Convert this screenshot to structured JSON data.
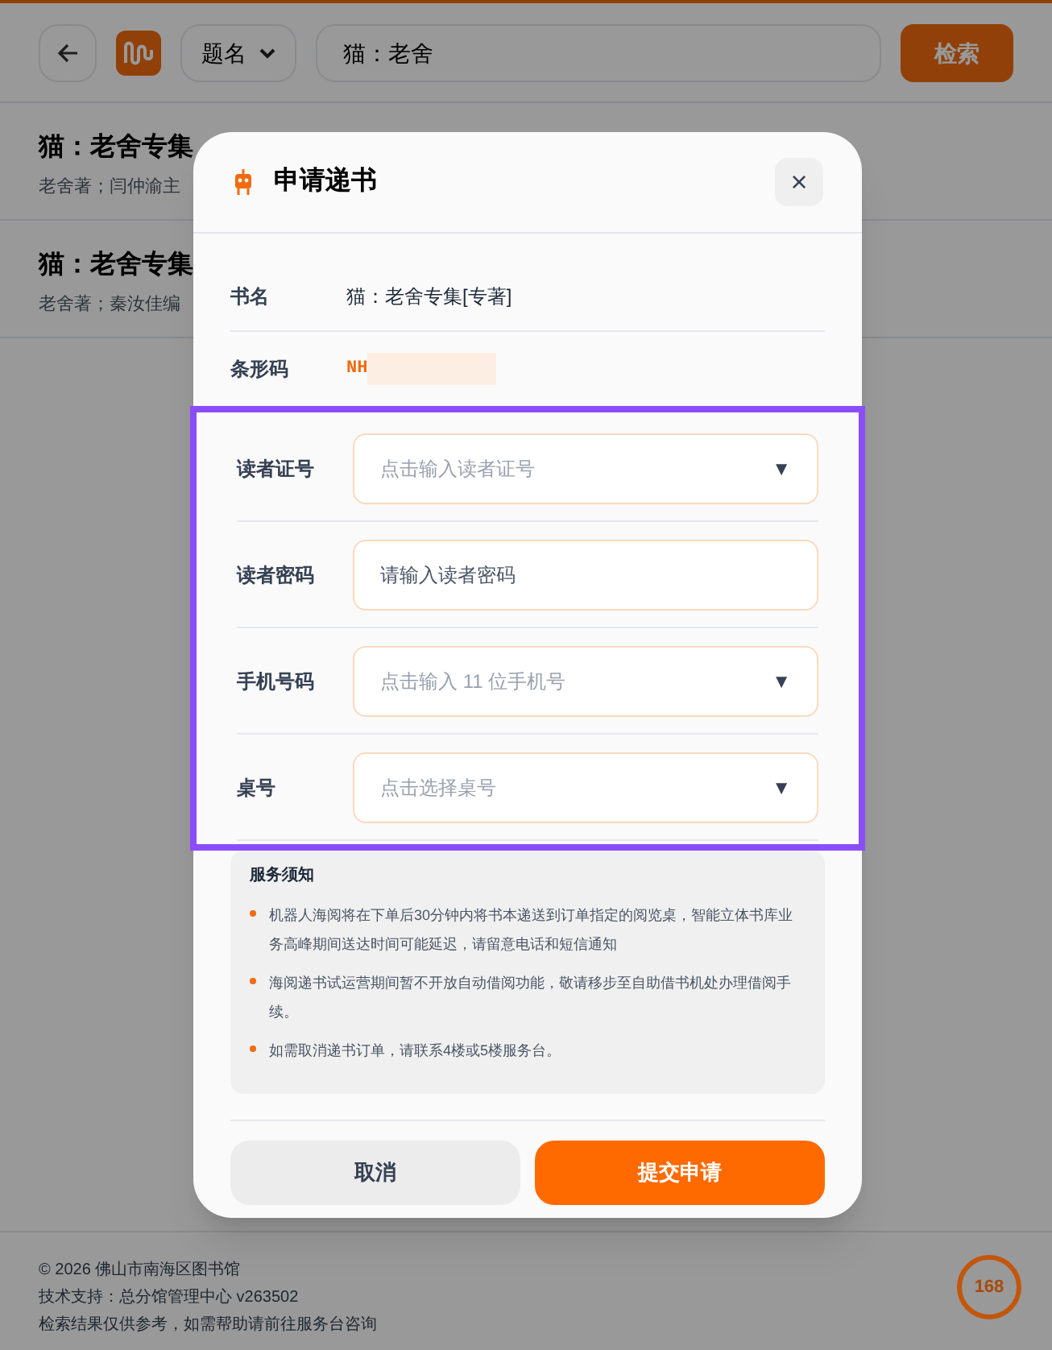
{
  "header": {
    "search_type": "题名",
    "search_value": "猫：老舍",
    "search_button": "检索"
  },
  "results": [
    {
      "title": "猫：老舍专集",
      "meta": "老舍著；闫仲渝主"
    },
    {
      "title": "猫：老舍专集",
      "meta": "老舍著；秦汝佳编"
    }
  ],
  "dialog": {
    "title": "申请递书",
    "close": "×",
    "info": [
      {
        "label": "书名",
        "value": "猫：老舍专集[专著]",
        "kind": "text"
      },
      {
        "label": "条形码",
        "value": "NH",
        "kind": "redacted"
      }
    ],
    "form_highlighted": true,
    "fields": [
      {
        "label": "读者证号",
        "placeholder": "点击输入读者证号",
        "kind": "dropdown",
        "caret": "▼"
      },
      {
        "label": "读者密码",
        "placeholder": "请输入读者密码",
        "kind": "input"
      },
      {
        "label": "手机号码",
        "placeholder": "点击输入 11 位手机号",
        "kind": "dropdown",
        "caret": "▼"
      },
      {
        "label": "桌号",
        "placeholder": "点击选择桌号",
        "kind": "dropdown",
        "caret": "▼"
      }
    ],
    "notice": {
      "title": "服务须知",
      "items": [
        "机器人海阅将在下单后30分钟内将书本递送到订单指定的阅览桌，智能立体书库业务高峰期间送达时间可能延迟，请留意电话和短信通知",
        "海阅递书试运营期间暂不开放自动借阅功能，敬请移步至自助借书机处办理借阅手续。",
        "如需取消递书订单，请联系4楼或5楼服务台。"
      ]
    },
    "buttons": [
      {
        "label": "取消",
        "kind": "secondary"
      },
      {
        "label": "提交申请",
        "kind": "primary"
      }
    ]
  },
  "footer": {
    "lines": [
      "© 2026 佛山市南海区图书馆",
      "技术支持：总分馆管理中心 v263502",
      "检索结果仅供参考，如需帮助请前往服务台咨询"
    ],
    "counter": "168"
  }
}
